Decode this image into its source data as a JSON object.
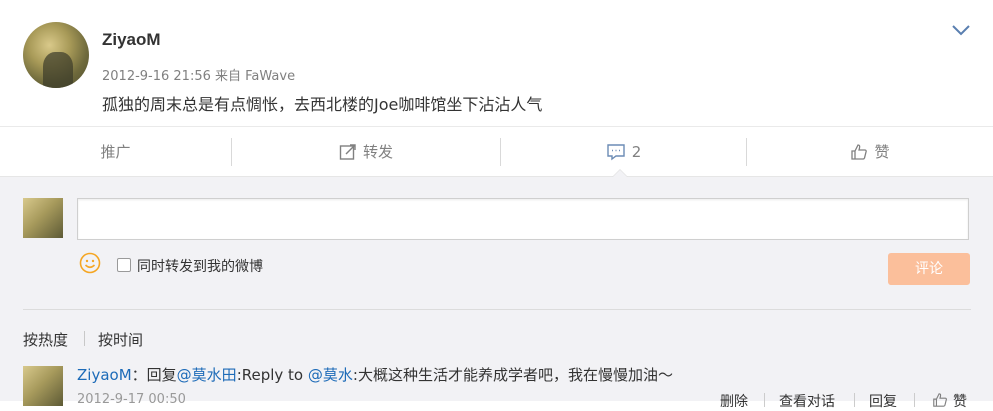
{
  "post": {
    "username": "ZiyaoM",
    "meta": "2012-9-16 21:56 来自 FaWave",
    "content": "孤独的周末总是有点惆怅，去西北楼的Joe咖啡馆坐下沾沾人气"
  },
  "actions": {
    "promote": "推广",
    "repost": "转发",
    "comment_count": "2",
    "like": "赞"
  },
  "compose": {
    "input_value": "",
    "checkbox_label": "同时转发到我的微博",
    "submit_label": "评论"
  },
  "sort": {
    "hot": "按热度",
    "time": "按时间"
  },
  "comments": [
    {
      "user": "ZiyaoM",
      "colon": "：",
      "reply_prefix": "回复",
      "mention1": "@莫水田",
      "mid_text": ":Reply to ",
      "mention2": "@莫水",
      "tail": ":大概这种生活才能养成学者吧，我在慢慢加油～",
      "time": "2012-9-17 00:50",
      "delete_label": "删除",
      "view_convo_label": "查看对话",
      "reply_label": "回复",
      "like_label": "赞"
    }
  ],
  "colors": {
    "link": "#1d6bb8",
    "submit_disabled": "#fbbf9b",
    "smiley": "#f5a623",
    "gray_text": "#808080"
  },
  "icons": [
    "chevron-down-icon",
    "repost-icon",
    "comment-icon",
    "thumbs-up-icon",
    "smiley-icon"
  ]
}
